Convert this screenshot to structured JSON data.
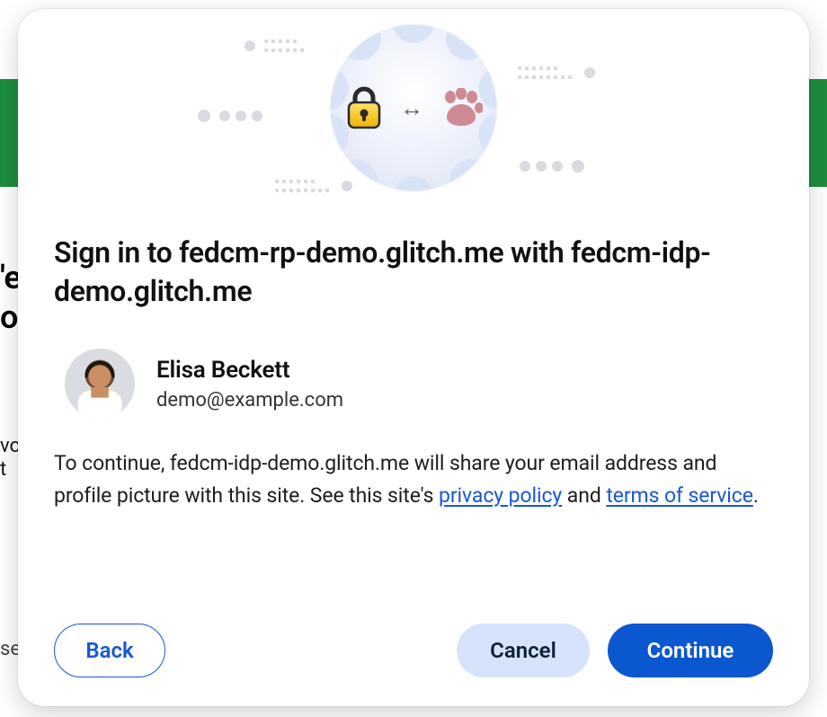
{
  "background": {
    "heading_fragment_1": "'e",
    "heading_fragment_2": "o",
    "side_fragment_1": "vo",
    "side_fragment_2": "t",
    "bottom_fragment": "se"
  },
  "dialog": {
    "heading": "Sign in to fedcm-rp-demo.glitch.me with fedcm-idp-demo.glitch.me",
    "account": {
      "name": "Elisa Beckett",
      "email": "demo@example.com"
    },
    "consent": {
      "text_before": "To continue, fedcm-idp-demo.glitch.me will share your email address and profile picture with this site. See this site's ",
      "privacy_label": "privacy policy",
      "middle": " and ",
      "terms_label": "terms of service",
      "after": "."
    },
    "buttons": {
      "back": "Back",
      "cancel": "Cancel",
      "continue": "Continue"
    },
    "icons": {
      "lock": "lock-icon",
      "arrows": "↔",
      "paw": "paw-icon"
    }
  }
}
